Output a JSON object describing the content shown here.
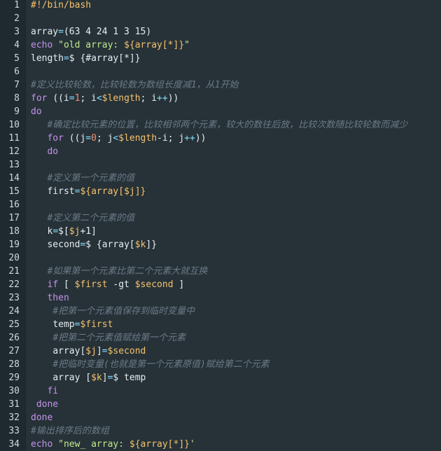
{
  "editor": {
    "lines": [
      {
        "n": "1",
        "tokens": [
          {
            "t": "#!/bin/bash",
            "c": "sh"
          }
        ]
      },
      {
        "n": "2",
        "tokens": []
      },
      {
        "n": "3",
        "tokens": [
          {
            "t": "array",
            "c": "pl"
          },
          {
            "t": "=",
            "c": "op"
          },
          {
            "t": "(63 4 24 1 3 15)",
            "c": "pl"
          }
        ]
      },
      {
        "n": "4",
        "tokens": [
          {
            "t": "echo ",
            "c": "kw"
          },
          {
            "t": "\"old array: ",
            "c": "str"
          },
          {
            "t": "${array[*]}",
            "c": "var"
          },
          {
            "t": "\"",
            "c": "str"
          }
        ]
      },
      {
        "n": "5",
        "tokens": [
          {
            "t": "length",
            "c": "pl"
          },
          {
            "t": "=",
            "c": "op"
          },
          {
            "t": "$ {#array[*]}",
            "c": "pl"
          }
        ]
      },
      {
        "n": "6",
        "tokens": []
      },
      {
        "n": "7",
        "tokens": [
          {
            "t": "#定义比较轮数，比较轮数为数组长度减1，从1开始",
            "c": "cm"
          }
        ]
      },
      {
        "n": "8",
        "tokens": [
          {
            "t": "for ",
            "c": "kw"
          },
          {
            "t": "((",
            "c": "pl"
          },
          {
            "t": "i",
            "c": "pl"
          },
          {
            "t": "=",
            "c": "op"
          },
          {
            "t": "1",
            "c": "num"
          },
          {
            "t": "; i",
            "c": "pl"
          },
          {
            "t": "<",
            "c": "op"
          },
          {
            "t": "$length",
            "c": "var"
          },
          {
            "t": "; i",
            "c": "pl"
          },
          {
            "t": "++",
            "c": "op"
          },
          {
            "t": "))",
            "c": "pl"
          }
        ]
      },
      {
        "n": "9",
        "tokens": [
          {
            "t": "do",
            "c": "kw"
          }
        ]
      },
      {
        "n": "10",
        "tokens": [
          {
            "t": "   ",
            "c": "pl"
          },
          {
            "t": "#确定比较元素的位置，比较相邻两个元素，较大的数往后放，比较次数随比较轮数而减少",
            "c": "cm"
          }
        ]
      },
      {
        "n": "11",
        "tokens": [
          {
            "t": "   ",
            "c": "pl"
          },
          {
            "t": "for ",
            "c": "kw"
          },
          {
            "t": "((",
            "c": "pl"
          },
          {
            "t": "j",
            "c": "pl"
          },
          {
            "t": "=",
            "c": "op"
          },
          {
            "t": "0",
            "c": "num"
          },
          {
            "t": "; j",
            "c": "pl"
          },
          {
            "t": "<",
            "c": "op"
          },
          {
            "t": "$length",
            "c": "var"
          },
          {
            "t": "-i; j",
            "c": "pl"
          },
          {
            "t": "++",
            "c": "op"
          },
          {
            "t": "))",
            "c": "pl"
          }
        ]
      },
      {
        "n": "12",
        "tokens": [
          {
            "t": "   ",
            "c": "pl"
          },
          {
            "t": "do",
            "c": "kw"
          }
        ]
      },
      {
        "n": "13",
        "tokens": []
      },
      {
        "n": "14",
        "tokens": [
          {
            "t": "   ",
            "c": "pl"
          },
          {
            "t": "#定义第一个元素的值",
            "c": "cm"
          }
        ]
      },
      {
        "n": "15",
        "tokens": [
          {
            "t": "   ",
            "c": "pl"
          },
          {
            "t": "first",
            "c": "pl"
          },
          {
            "t": "=",
            "c": "op"
          },
          {
            "t": "${array[$j]}",
            "c": "var"
          }
        ]
      },
      {
        "n": "16",
        "tokens": []
      },
      {
        "n": "17",
        "tokens": [
          {
            "t": "   ",
            "c": "pl"
          },
          {
            "t": "#定义第二个元素的值",
            "c": "cm"
          }
        ]
      },
      {
        "n": "18",
        "tokens": [
          {
            "t": "   ",
            "c": "pl"
          },
          {
            "t": "k",
            "c": "pl"
          },
          {
            "t": "=",
            "c": "op"
          },
          {
            "t": "$[",
            "c": "pl"
          },
          {
            "t": "$j",
            "c": "var"
          },
          {
            "t": "+1]",
            "c": "pl"
          }
        ]
      },
      {
        "n": "19",
        "tokens": [
          {
            "t": "   ",
            "c": "pl"
          },
          {
            "t": "second",
            "c": "pl"
          },
          {
            "t": "=",
            "c": "op"
          },
          {
            "t": "$ {array[",
            "c": "pl"
          },
          {
            "t": "$k",
            "c": "var"
          },
          {
            "t": "]}",
            "c": "pl"
          }
        ]
      },
      {
        "n": "20",
        "tokens": []
      },
      {
        "n": "21",
        "tokens": [
          {
            "t": "   ",
            "c": "pl"
          },
          {
            "t": "#如果第一个元素比第二个元素大就互换",
            "c": "cm"
          }
        ]
      },
      {
        "n": "22",
        "tokens": [
          {
            "t": "   ",
            "c": "pl"
          },
          {
            "t": "if ",
            "c": "kw"
          },
          {
            "t": "[ ",
            "c": "pl"
          },
          {
            "t": "$first",
            "c": "var"
          },
          {
            "t": " -gt ",
            "c": "pl"
          },
          {
            "t": "$second",
            "c": "var"
          },
          {
            "t": " ]",
            "c": "pl"
          }
        ]
      },
      {
        "n": "23",
        "tokens": [
          {
            "t": "   ",
            "c": "pl"
          },
          {
            "t": "then",
            "c": "kw"
          }
        ]
      },
      {
        "n": "24",
        "tokens": [
          {
            "t": "    ",
            "c": "pl"
          },
          {
            "t": "#把第一个元素值保存到临时变量中",
            "c": "cm"
          }
        ]
      },
      {
        "n": "25",
        "tokens": [
          {
            "t": "    ",
            "c": "pl"
          },
          {
            "t": "temp",
            "c": "pl"
          },
          {
            "t": "=",
            "c": "op"
          },
          {
            "t": "$first",
            "c": "var"
          }
        ]
      },
      {
        "n": "26",
        "tokens": [
          {
            "t": "    ",
            "c": "pl"
          },
          {
            "t": "#把第二个元素值赋给第一个元素",
            "c": "cm"
          }
        ]
      },
      {
        "n": "27",
        "tokens": [
          {
            "t": "    ",
            "c": "pl"
          },
          {
            "t": "array[",
            "c": "pl"
          },
          {
            "t": "$j",
            "c": "var"
          },
          {
            "t": "]",
            "c": "pl"
          },
          {
            "t": "=",
            "c": "op"
          },
          {
            "t": "$second",
            "c": "var"
          }
        ]
      },
      {
        "n": "28",
        "tokens": [
          {
            "t": "    ",
            "c": "pl"
          },
          {
            "t": "#把临时变量(也就是第一个元素原值)赋给第二个元素",
            "c": "cm"
          }
        ]
      },
      {
        "n": "29",
        "tokens": [
          {
            "t": "    ",
            "c": "pl"
          },
          {
            "t": "array [",
            "c": "pl"
          },
          {
            "t": "$k",
            "c": "var"
          },
          {
            "t": "]",
            "c": "pl"
          },
          {
            "t": "=",
            "c": "op"
          },
          {
            "t": "$ temp",
            "c": "pl"
          }
        ]
      },
      {
        "n": "30",
        "tokens": [
          {
            "t": "   ",
            "c": "pl"
          },
          {
            "t": "fi",
            "c": "kw"
          }
        ]
      },
      {
        "n": "31",
        "tokens": [
          {
            "t": " ",
            "c": "pl"
          },
          {
            "t": "done",
            "c": "kw"
          }
        ]
      },
      {
        "n": "32",
        "tokens": [
          {
            "t": "done",
            "c": "kw"
          }
        ]
      },
      {
        "n": "33",
        "tokens": [
          {
            "t": "#输出排序后的数组",
            "c": "cm"
          }
        ]
      },
      {
        "n": "34",
        "tokens": [
          {
            "t": "echo ",
            "c": "kw"
          },
          {
            "t": "\"new_ array: ",
            "c": "str"
          },
          {
            "t": "${array[*]}",
            "c": "var"
          },
          {
            "t": "'",
            "c": "str"
          }
        ]
      }
    ]
  },
  "colors": {
    "background": "#263238",
    "gutter": "#1f2a30",
    "keyword": "#c792ea",
    "operator": "#89ddff",
    "number": "#f78c6c",
    "string": "#c3e88d",
    "variable": "#f7c26c",
    "comment": "#6c7a87"
  }
}
